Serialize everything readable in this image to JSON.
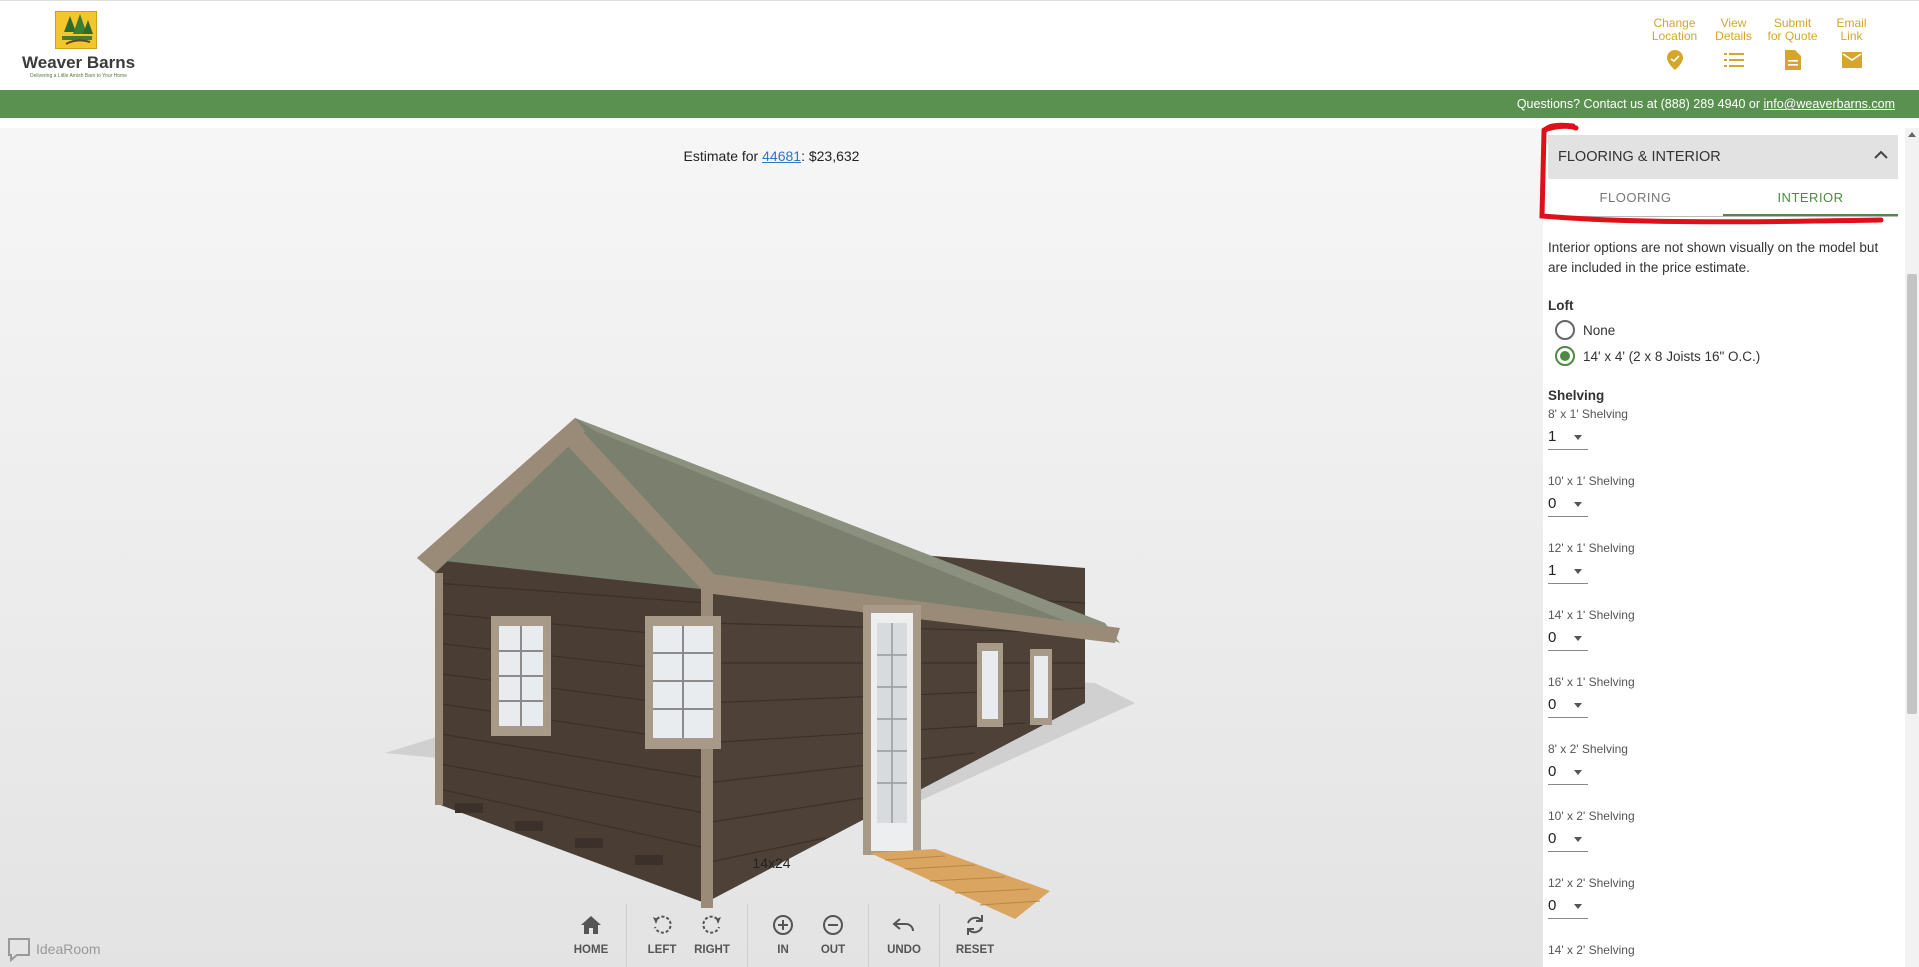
{
  "brand": {
    "name": "Weaver Barns",
    "tagline": "Delivering a Little Amish Barn to Your Home"
  },
  "header_actions": [
    {
      "label_line1": "Change",
      "label_line2": "Location",
      "icon": "location-pin-icon"
    },
    {
      "label_line1": "View",
      "label_line2": "Details",
      "icon": "list-icon"
    },
    {
      "label_line1": "Submit",
      "label_line2": "for Quote",
      "icon": "document-icon"
    },
    {
      "label_line1": "Email",
      "label_line2": "Link",
      "icon": "envelope-icon"
    }
  ],
  "contact_bar": {
    "text": "Questions? Contact us at (888) 289 4940 or ",
    "email": "info@weaverbarns.com"
  },
  "viewer": {
    "estimate_prefix": "Estimate for ",
    "zip": "44681",
    "estimate_suffix": ": $23,632",
    "size": "14x24",
    "powered_by": "IdeaRoom"
  },
  "toolbar": {
    "home": "HOME",
    "left": "LEFT",
    "right": "RIGHT",
    "in": "IN",
    "out": "OUT",
    "undo": "UNDO",
    "reset": "RESET"
  },
  "panel": {
    "section_title": "FLOORING & INTERIOR",
    "tabs": [
      {
        "label": "FLOORING",
        "active": false
      },
      {
        "label": "INTERIOR",
        "active": true
      }
    ],
    "note": "Interior options are not shown visually on the model but are included in the price estimate.",
    "loft": {
      "title": "Loft",
      "options": [
        {
          "label": "None",
          "selected": false
        },
        {
          "label": "14' x 4' (2 x 8 Joists 16\" O.C.)",
          "selected": true
        }
      ]
    },
    "shelving": {
      "title": "Shelving",
      "items": [
        {
          "label": "8' x 1' Shelving",
          "value": "1"
        },
        {
          "label": "10' x 1' Shelving",
          "value": "0"
        },
        {
          "label": "12' x 1' Shelving",
          "value": "1"
        },
        {
          "label": "14' x 1' Shelving",
          "value": "0"
        },
        {
          "label": "16' x 1' Shelving",
          "value": "0"
        },
        {
          "label": "8' x 2' Shelving",
          "value": "0"
        },
        {
          "label": "10' x 2' Shelving",
          "value": "0"
        },
        {
          "label": "12' x 2' Shelving",
          "value": "0"
        },
        {
          "label": "14' x 2' Shelving",
          "value": ""
        }
      ]
    }
  },
  "colors": {
    "accent_gold": "#d6a52c",
    "bar_green": "#5b9150",
    "tab_green": "#4f8a43",
    "annotation_red": "#e0101a"
  }
}
